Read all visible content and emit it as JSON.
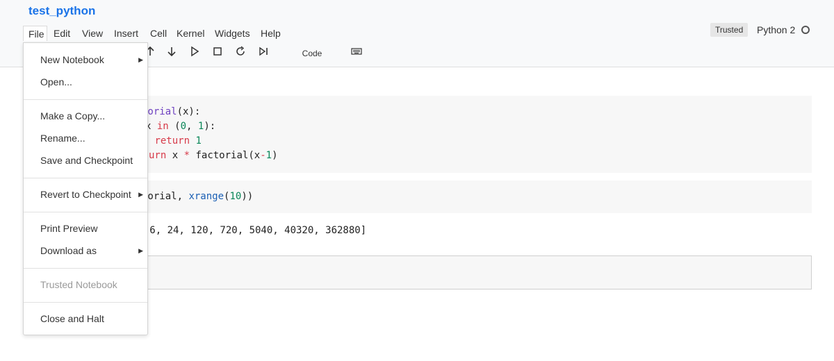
{
  "notebook": {
    "title": "test_python"
  },
  "menubar": {
    "items": [
      {
        "id": "file",
        "label": "File"
      },
      {
        "id": "edit",
        "label": "Edit"
      },
      {
        "id": "view",
        "label": "View"
      },
      {
        "id": "insert",
        "label": "Insert"
      },
      {
        "id": "cell",
        "label": "Cell"
      },
      {
        "id": "kernel",
        "label": "Kernel"
      },
      {
        "id": "widgets",
        "label": "Widgets"
      },
      {
        "id": "help",
        "label": "Help"
      }
    ]
  },
  "status": {
    "trusted": "Trusted",
    "kernel_name": "Python 2"
  },
  "toolbar": {
    "icons": [
      "move-up-icon",
      "move-down-icon",
      "run-icon",
      "stop-icon",
      "restart-icon",
      "run-all-icon",
      "keyboard-icon"
    ],
    "cell_type": "Code"
  },
  "file_menu": {
    "items": [
      {
        "label": "New Notebook",
        "submenu": true
      },
      {
        "label": "Open..."
      },
      {
        "label": "Make a Copy..."
      },
      {
        "label": "Rename..."
      },
      {
        "label": "Save and Checkpoint"
      },
      {
        "label": "Revert to Checkpoint",
        "submenu": true
      },
      {
        "label": "Print Preview"
      },
      {
        "label": "Download as",
        "submenu": true
      },
      {
        "label": "Trusted Notebook",
        "disabled": true
      },
      {
        "label": "Close and Halt"
      }
    ]
  },
  "cells": {
    "cell1": {
      "lines": [
        [
          {
            "t": "torial",
            "c": "fn"
          },
          {
            "t": "(x):"
          }
        ],
        [
          {
            "t": "x "
          },
          {
            "t": "in",
            "c": "kw"
          },
          {
            "t": " ("
          },
          {
            "t": "0",
            "c": "num"
          },
          {
            "t": ", "
          },
          {
            "t": "1",
            "c": "num"
          },
          {
            "t": "):"
          }
        ],
        [
          {
            "t": " "
          },
          {
            "t": "return",
            "c": "kw"
          },
          {
            "t": " "
          },
          {
            "t": "1",
            "c": "num"
          }
        ],
        [
          {
            "t": "urn",
            "c": "kw"
          },
          {
            "t": " x "
          },
          {
            "t": "*",
            "c": "op"
          },
          {
            "t": " factorial(x"
          },
          {
            "t": "-",
            "c": "op"
          },
          {
            "t": "1",
            "c": "num"
          },
          {
            "t": ")"
          }
        ]
      ]
    },
    "cell2": {
      "lines": [
        [
          {
            "t": "torial, "
          },
          {
            "t": "xrange",
            "c": "bi"
          },
          {
            "t": "("
          },
          {
            "t": "10",
            "c": "num"
          },
          {
            "t": "))"
          }
        ]
      ]
    },
    "output1": "2, 6, 24, 120, 720, 5040, 40320, 362880]"
  }
}
